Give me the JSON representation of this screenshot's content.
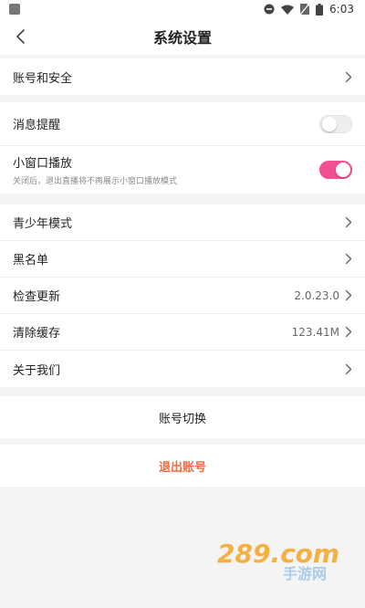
{
  "status": {
    "time": "6:03"
  },
  "nav": {
    "title": "系统设置"
  },
  "account_security": {
    "label": "账号和安全"
  },
  "notifications": {
    "message_alert": {
      "label": "消息提醒",
      "enabled": false
    },
    "mini_window": {
      "label": "小窗口播放",
      "desc": "关闭后，退出直播将不再展示小窗口播放模式",
      "enabled": true
    }
  },
  "menu": [
    {
      "label": "青少年模式",
      "value": ""
    },
    {
      "label": "黑名单",
      "value": ""
    },
    {
      "label": "检查更新",
      "value": "2.0.23.0"
    },
    {
      "label": "清除缓存",
      "value": "123.41M"
    },
    {
      "label": "关于我们",
      "value": ""
    }
  ],
  "switch_account": {
    "label": "账号切换"
  },
  "logout": {
    "label": "退出账号"
  },
  "watermark": {
    "text_top": "289.com",
    "text_bottom": "手游网"
  },
  "colors": {
    "accent_pink": "#f34d93",
    "logout_orange": "#f06a3c"
  }
}
